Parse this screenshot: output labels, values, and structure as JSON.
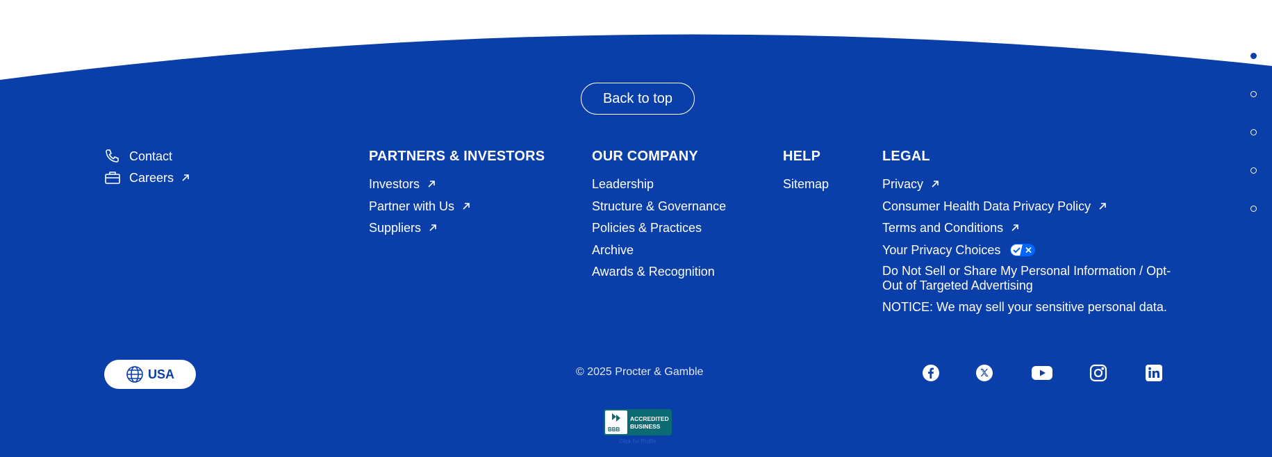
{
  "back_to_top": "Back to top",
  "quick_links": [
    {
      "label": "Contact",
      "icon": "phone-icon",
      "external": false
    },
    {
      "label": "Careers",
      "icon": "briefcase-icon",
      "external": true
    }
  ],
  "columns": {
    "partners": {
      "heading": "PARTNERS & INVESTORS",
      "items": [
        {
          "label": "Investors",
          "external": true
        },
        {
          "label": "Partner with Us",
          "external": true
        },
        {
          "label": "Suppliers",
          "external": true
        }
      ]
    },
    "company": {
      "heading": "OUR COMPANY",
      "items": [
        {
          "label": "Leadership"
        },
        {
          "label": "Structure & Governance"
        },
        {
          "label": "Policies & Practices"
        },
        {
          "label": "Archive"
        },
        {
          "label": "Awards & Recognition"
        }
      ]
    },
    "help": {
      "heading": "HELP",
      "items": [
        {
          "label": "Sitemap"
        }
      ]
    },
    "legal": {
      "heading": "LEGAL",
      "items": [
        {
          "label": "Privacy",
          "external": true
        },
        {
          "label": "Consumer Health Data Privacy Policy",
          "external": true
        },
        {
          "label": "Terms and Conditions",
          "external": true
        },
        {
          "label": "Your Privacy Choices",
          "icon": "privacy-choices-icon"
        },
        {
          "label": "Do Not Sell or Share My Personal Information / Opt-Out of Targeted Advertising"
        }
      ],
      "notice": "NOTICE: We may sell your sensitive personal data."
    }
  },
  "country": {
    "label": "USA",
    "icon": "globe-icon"
  },
  "copyright": "© 2025 Procter & Gamble",
  "social": [
    "facebook-icon",
    "x-twitter-icon",
    "youtube-icon",
    "instagram-icon",
    "linkedin-icon"
  ],
  "bbb": {
    "line1": "ACCREDITED",
    "line2": "BUSINESS",
    "mark": "BBB",
    "sub": "Click for Profile"
  },
  "pager": {
    "count": 5,
    "active": 0
  },
  "colors": {
    "brand_blue": "#0a3ea8",
    "white": "#ffffff",
    "bbb_teal": "#0c6a73"
  }
}
